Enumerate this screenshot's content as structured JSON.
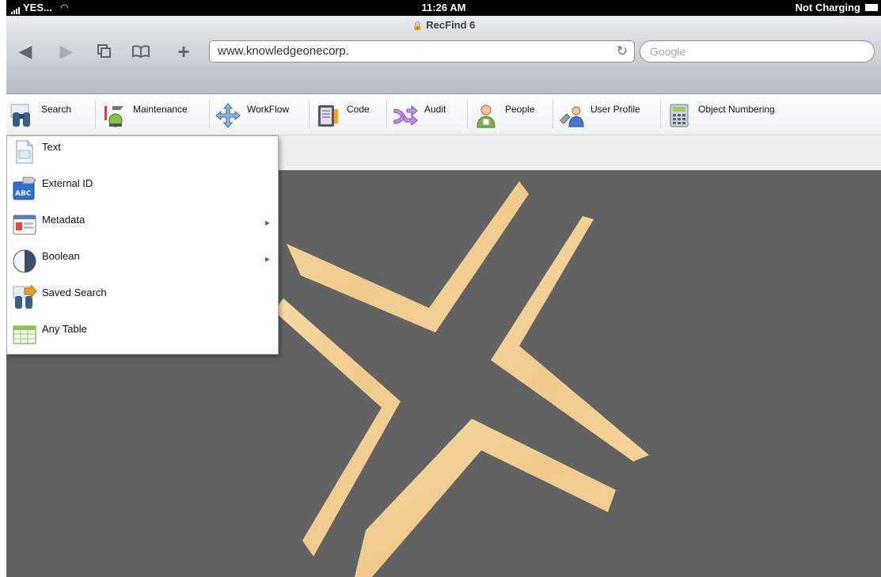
{
  "status_bar": {
    "carrier": "YES...",
    "time": "11:26 AM",
    "battery_text": "Not Charging"
  },
  "browser": {
    "page_title": "RecFind 6",
    "url": "www.knowledgeonecorp.",
    "search_placeholder": "Google"
  },
  "toolbar": {
    "items": [
      {
        "label": "Search",
        "icon": "binoculars-icon"
      },
      {
        "label": "Maintenance",
        "icon": "maintenance-tools-icon"
      },
      {
        "label": "WorkFlow",
        "icon": "workflow-arrows-icon"
      },
      {
        "label": "Code",
        "icon": "code-book-icon"
      },
      {
        "label": "Audit",
        "icon": "audit-shuffle-icon"
      },
      {
        "label": "People",
        "icon": "person-icon"
      },
      {
        "label": "User Profile",
        "icon": "user-profile-icon"
      },
      {
        "label": "Object Numbering",
        "icon": "calculator-icon"
      }
    ]
  },
  "search_menu": {
    "items": [
      {
        "label": "Text",
        "icon": "text-document-icon",
        "has_submenu": false
      },
      {
        "label": "External ID",
        "icon": "abc-tag-icon",
        "has_submenu": false
      },
      {
        "label": "Metadata",
        "icon": "metadata-form-icon",
        "has_submenu": true
      },
      {
        "label": "Boolean",
        "icon": "boolean-circle-icon",
        "has_submenu": true
      },
      {
        "label": "Saved Search",
        "icon": "saved-search-icon",
        "has_submenu": false
      },
      {
        "label": "Any Table",
        "icon": "table-grid-icon",
        "has_submenu": false
      }
    ]
  },
  "colors": {
    "canvas_background": "#626262",
    "logo_color": "#f3cf95"
  }
}
